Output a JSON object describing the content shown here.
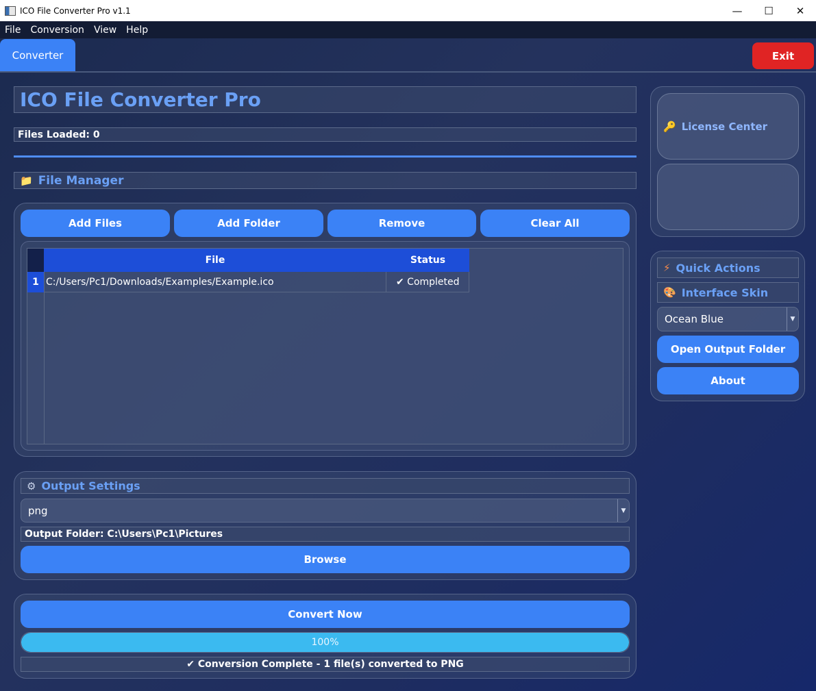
{
  "window": {
    "title": "ICO File Converter Pro v1.1"
  },
  "menu": [
    "File",
    "Conversion",
    "View",
    "Help"
  ],
  "tabs": {
    "converter": "Converter",
    "exit": "Exit"
  },
  "header": {
    "title": "ICO File Converter Pro",
    "files_loaded": "Files Loaded: 0"
  },
  "file_manager": {
    "title": "File Manager",
    "buttons": {
      "add_files": "Add Files",
      "add_folder": "Add Folder",
      "remove": "Remove",
      "clear_all": "Clear All"
    },
    "columns": {
      "file": "File",
      "status": "Status"
    },
    "rows": [
      {
        "num": "1",
        "file": "C:/Users/Pc1/Downloads/Examples/Example.ico",
        "status": "✔ Completed"
      }
    ]
  },
  "output_settings": {
    "title": "Output Settings",
    "format": "png",
    "folder": "Output Folder: C:\\Users\\Pc1\\Pictures",
    "browse": "Browse"
  },
  "convert": {
    "button": "Convert Now",
    "progress_percent": 100,
    "progress_text": "100%",
    "status": "✔ Conversion Complete - 1 file(s) converted to PNG"
  },
  "sidebar": {
    "license_center": "License Center",
    "quick_actions": "Quick Actions",
    "interface_skin": "Interface Skin",
    "skin_value": "Ocean Blue",
    "open_output_folder": "Open Output Folder",
    "about": "About"
  },
  "colors": {
    "accent": "#3b82f6",
    "exit": "#e02424",
    "header_text": "#6aa0f5",
    "progress": "#3bbaf0",
    "table_header": "#1d4ed8"
  }
}
